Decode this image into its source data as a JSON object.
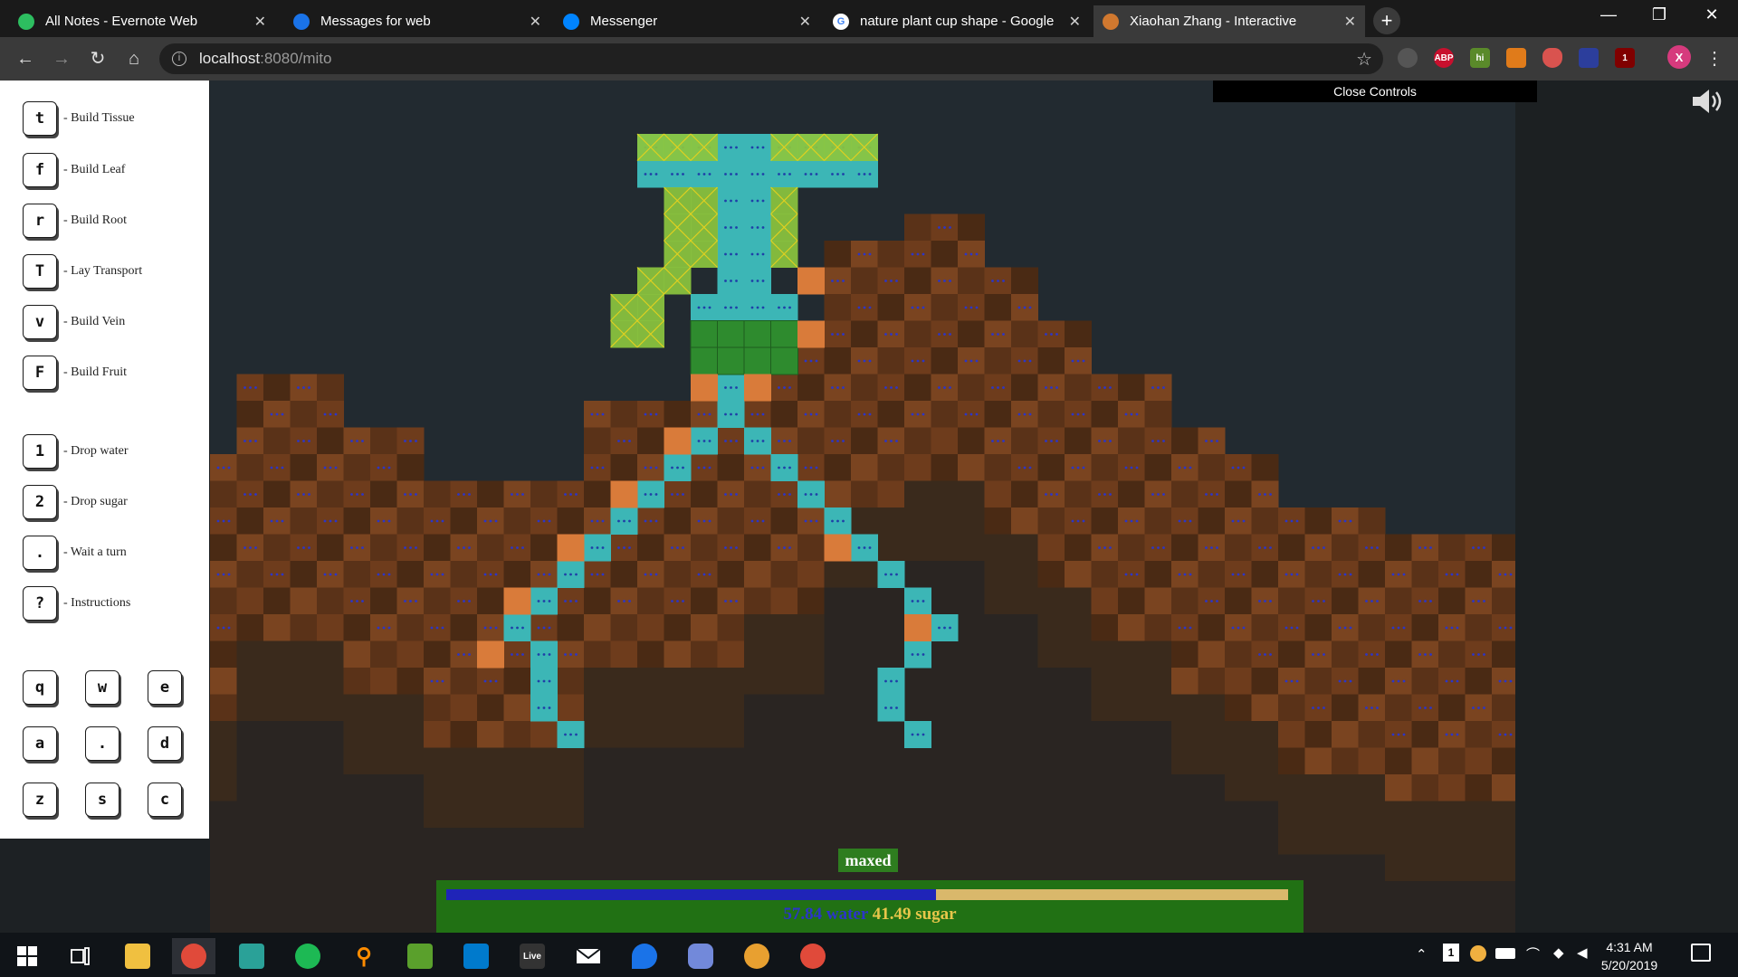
{
  "browser": {
    "tabs": [
      {
        "title": "All Notes - Evernote Web",
        "icon": "evernote-icon",
        "icon_color": "#2dbe60"
      },
      {
        "title": "Messages for web",
        "icon": "messages-icon",
        "icon_color": "#1a73e8"
      },
      {
        "title": "Messenger",
        "icon": "messenger-icon",
        "icon_color": "#0084ff"
      },
      {
        "title": "nature plant cup shape - Google",
        "icon": "google-icon",
        "icon_color": "#ffffff"
      },
      {
        "title": "Xiaohan Zhang - Interactive",
        "icon": "globe-icon",
        "icon_color": "#d0782f"
      }
    ],
    "new_tab_label": "+",
    "url_host": "localhost",
    "url_path": ":8080/mito",
    "extensions": [
      {
        "name": "plug-extension-icon",
        "label": "",
        "color": "#555555"
      },
      {
        "name": "adblock-plus-icon",
        "label": "ABP",
        "color": "#c8102e"
      },
      {
        "name": "honey-extension-icon",
        "label": "hi",
        "color": "#5a8a2a"
      },
      {
        "name": "notes-extension-icon",
        "label": "",
        "color": "#e07b1a"
      },
      {
        "name": "shield-extension-icon",
        "label": "",
        "color": "#d9534f"
      },
      {
        "name": "grid-extension-icon",
        "label": "",
        "color": "#2c3e9c"
      },
      {
        "name": "ublock-origin-icon",
        "label": "1",
        "color": "#800000"
      },
      {
        "name": "profile-avatar-icon",
        "label": "X",
        "color": "#d63a7d"
      }
    ]
  },
  "game": {
    "close_controls_label": "Close Controls",
    "controls": [
      {
        "key": "t",
        "label": "- Build Tissue"
      },
      {
        "key": "f",
        "label": "- Build Leaf"
      },
      {
        "key": "r",
        "label": "- Build Root"
      },
      {
        "key": "T",
        "label": "- Lay Transport"
      },
      {
        "key": "v",
        "label": "- Build Vein"
      },
      {
        "key": "F",
        "label": "- Build Fruit"
      },
      {
        "key": "1",
        "label": "- Drop water"
      },
      {
        "key": "2",
        "label": "- Drop sugar"
      },
      {
        "key": ".",
        "label": "- Wait a turn"
      },
      {
        "key": "?",
        "label": "- Instructions"
      }
    ],
    "movement_keys": [
      [
        "q",
        "w",
        "e"
      ],
      [
        "a",
        ".",
        "d"
      ],
      [
        "z",
        "s",
        "c"
      ]
    ],
    "maxed_label": "maxed",
    "resources": {
      "water_value": "57.84",
      "water_label": "water",
      "sugar_value": "41.49",
      "sugar_label": "sugar",
      "water_fraction": 0.582
    },
    "colors": {
      "sky": "#222a30",
      "soil": "#6e3c1c",
      "tissue": "#3cb6b6",
      "leaf": "#8cc63f",
      "fruit_seed": "#2e8b2e",
      "root": "#d97b3a",
      "water_dot": "#2b35c8",
      "bar_panel": "#217114"
    }
  },
  "taskbar": {
    "apps": [
      {
        "name": "windows-start-icon",
        "label": "",
        "color": "#ffffff"
      },
      {
        "name": "task-view-icon",
        "label": "",
        "color": "#ffffff"
      },
      {
        "name": "file-explorer-icon",
        "label": "",
        "color": "#f0c040"
      },
      {
        "name": "chrome-icon",
        "label": "",
        "color": "#e04a3a"
      },
      {
        "name": "terminal-icon",
        "label": "",
        "color": "#2aa198"
      },
      {
        "name": "spotify-icon",
        "label": "",
        "color": "#1db954"
      },
      {
        "name": "search-magnifier-icon",
        "label": "",
        "color": "#ff8c00"
      },
      {
        "name": "vim-icon",
        "label": "",
        "color": "#5aa02c"
      },
      {
        "name": "vscode-icon",
        "label": "",
        "color": "#007acc"
      },
      {
        "name": "live-icon",
        "label": "Live",
        "color": "#333333"
      },
      {
        "name": "mail-icon",
        "label": "",
        "color": "#ffffff"
      },
      {
        "name": "maps-icon",
        "label": "",
        "color": "#1a73e8"
      },
      {
        "name": "discord-icon",
        "label": "",
        "color": "#7289da"
      },
      {
        "name": "paint-icon",
        "label": "",
        "color": "#e8a030"
      },
      {
        "name": "chrome-profile-icon",
        "label": "",
        "color": "#e04a3a"
      }
    ],
    "notification_count": "1",
    "time": "4:31 AM",
    "date": "5/20/2019"
  }
}
